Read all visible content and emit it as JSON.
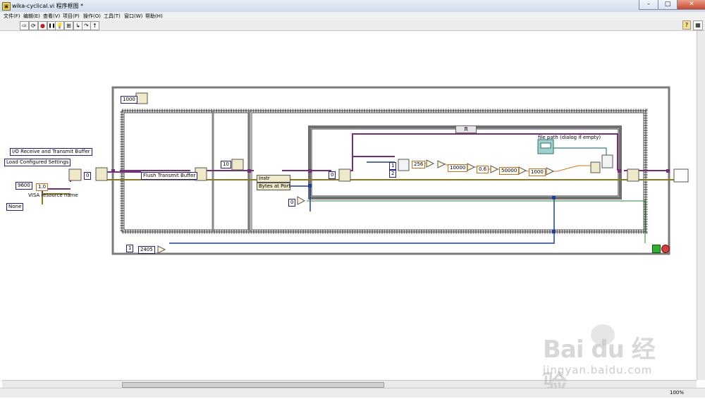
{
  "window": {
    "title": "wika-cyclical.vi 程序框图 *",
    "min": "–",
    "max": "□",
    "close": "✕"
  },
  "menu": [
    "文件(F)",
    "编辑(E)",
    "查看(V)",
    "项目(P)",
    "操作(O)",
    "工具(T)",
    "窗口(W)",
    "帮助(H)"
  ],
  "toolbar": {
    "run": "⇨",
    "run_cont": "⟳",
    "abort": "●",
    "pause": "❚❚",
    "help": "?"
  },
  "diagram": {
    "vi_rings": {
      "io_buffer": "I/O Receive and Transmit Buffer",
      "load_settings": "Load Configured Settings",
      "baud": "9600",
      "timeout": "1.0",
      "resource_label": "VISA resource name",
      "parity": "None"
    },
    "flush_ring": "Flush Transmit Buffer",
    "wait_ms": "1000",
    "wait_10": "10",
    "property_node": {
      "class": "Instr",
      "prop": "Bytes at Port"
    },
    "case_selector": "真",
    "file_path_label": "file path (dialog if empty)",
    "constants": {
      "zero_a": "0",
      "zero_b": "0",
      "zero_c": "0",
      "c256": "256",
      "c10000": "10000",
      "c06": "0.6",
      "c50000": "50000",
      "c1000": "1000",
      "c2405": "2405",
      "one_a": "1",
      "one_b": "2",
      "one_c": "1"
    }
  },
  "statusbar": {
    "zoom": "100%"
  },
  "watermark": {
    "main": "Bai du 经验",
    "sub": "jingyan.baidu.com"
  }
}
